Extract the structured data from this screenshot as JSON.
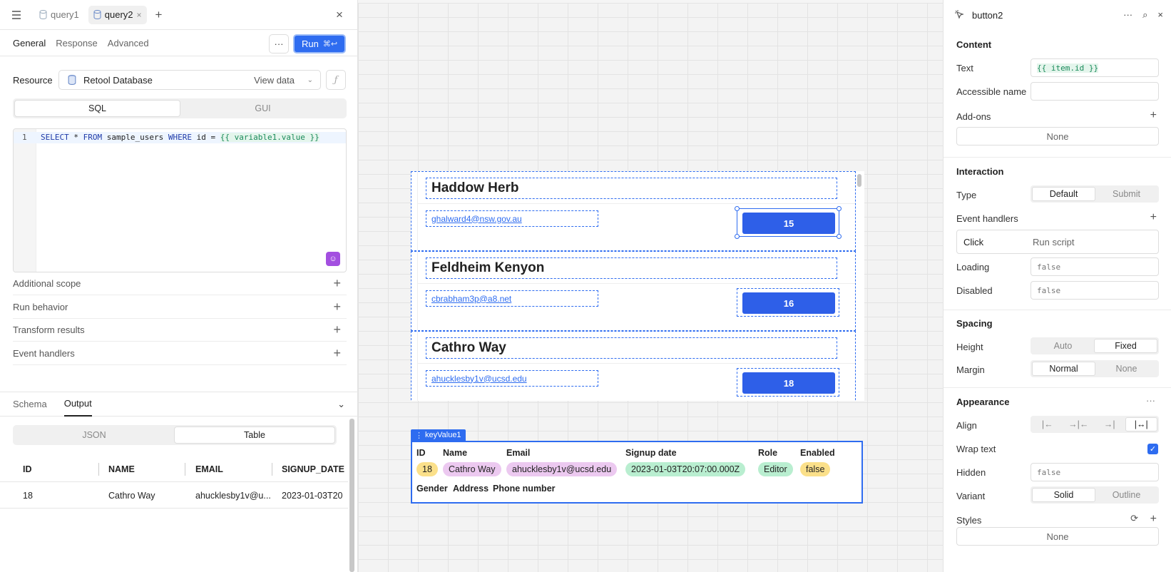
{
  "left": {
    "tabs": [
      {
        "label": "query1",
        "active": false
      },
      {
        "label": "query2",
        "active": true
      }
    ],
    "subtabs": [
      "General",
      "Response",
      "Advanced"
    ],
    "run": {
      "label": "Run",
      "shortcut": "⌘↩"
    },
    "resource": {
      "label": "Resource",
      "name": "Retool Database",
      "view": "View data"
    },
    "mode": {
      "options": [
        "SQL",
        "GUI"
      ],
      "selected": "SQL"
    },
    "editor": {
      "line": "1",
      "code_parts": [
        "SELECT",
        " * ",
        "FROM",
        " sample_users ",
        "WHERE",
        " id = ",
        "{{ variable1.value }}"
      ]
    },
    "sections": [
      "Additional scope",
      "Run behavior",
      "Transform results",
      "Event handlers"
    ],
    "bottom_tabs": [
      "Schema",
      "Output"
    ],
    "output_view": {
      "options": [
        "JSON",
        "Table"
      ],
      "selected": "Table"
    },
    "table": {
      "columns": [
        "ID",
        "NAME",
        "EMAIL",
        "SIGNUP_DATE"
      ],
      "rows": [
        [
          "18",
          "Cathro Way",
          "ahucklesby1v@u...",
          "2023-01-03T20"
        ]
      ]
    }
  },
  "canvas": {
    "list_items": [
      {
        "name": "Haddow Herb",
        "email": "ghalward4@nsw.gov.au",
        "id": "15"
      },
      {
        "name": "Feldheim Kenyon",
        "email": "cbrabham3p@a8.net",
        "id": "16"
      },
      {
        "name": "Cathro Way",
        "email": "ahucklesby1v@ucsd.edu",
        "id": "18"
      }
    ],
    "keyvalue": {
      "label": "keyValue1",
      "headers": [
        "ID",
        "Name",
        "Email",
        "Signup date",
        "Role",
        "Enabled"
      ],
      "values": [
        "18",
        "Cathro Way",
        "ahucklesby1v@ucsd.edu",
        "2023-01-03T20:07:00.000Z",
        "Editor",
        "false"
      ],
      "headers2": [
        "Gender",
        "Address",
        "Phone number"
      ],
      "colors": [
        "#fbe08a",
        "#ecc9f0",
        "#ecc9f0",
        "#b9eed0",
        "#b9eed0",
        "#fbe08a"
      ]
    }
  },
  "inspector": {
    "title": "button2",
    "content": {
      "heading": "Content",
      "text_label": "Text",
      "text_value": "{{ item.id }}",
      "accessible_label": "Accessible name",
      "addons_label": "Add-ons",
      "addons_value": "None"
    },
    "interaction": {
      "heading": "Interaction",
      "type_label": "Type",
      "type_options": [
        "Default",
        "Submit"
      ],
      "type_selected": "Default",
      "event_label": "Event handlers",
      "event_name": "Click",
      "event_action": "Run script",
      "loading_label": "Loading",
      "loading_value": "false",
      "disabled_label": "Disabled",
      "disabled_value": "false"
    },
    "spacing": {
      "heading": "Spacing",
      "height_label": "Height",
      "height_options": [
        "Auto",
        "Fixed"
      ],
      "height_selected": "Fixed",
      "margin_label": "Margin",
      "margin_options": [
        "Normal",
        "None"
      ],
      "margin_selected": "Normal"
    },
    "appearance": {
      "heading": "Appearance",
      "align_label": "Align",
      "wrap_label": "Wrap text",
      "hidden_label": "Hidden",
      "hidden_value": "false",
      "variant_label": "Variant",
      "variant_options": [
        "Solid",
        "Outline"
      ],
      "variant_selected": "Solid",
      "styles_label": "Styles",
      "styles_value": "None"
    }
  }
}
